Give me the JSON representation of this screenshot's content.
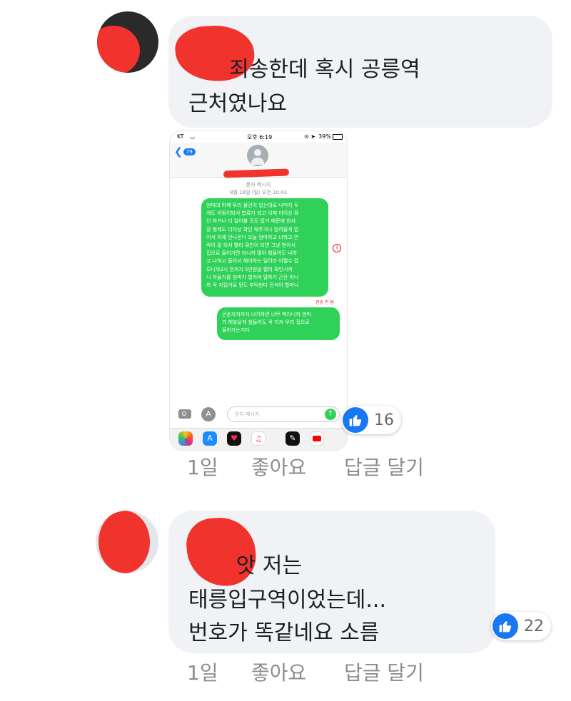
{
  "comments": [
    {
      "author": "",
      "text_lines": [
        "      죄송한데 혹시 공릉역",
        "근처였나요"
      ],
      "actions": {
        "time": "1일",
        "like": "좋아요",
        "reply": "답글 달기"
      },
      "reaction_count": "16"
    },
    {
      "author": "",
      "text_lines": [
        "       앗 저는",
        "태릉입구역이었는데...",
        "번호가 똑같네요 소름"
      ],
      "actions": {
        "time": "1일",
        "like": "좋아요",
        "reply": "답글 달기"
      },
      "reaction_count": "22"
    }
  ],
  "phone": {
    "carrier": "KT",
    "time": "오후 6:19",
    "battery": "39%",
    "back_badge": "79",
    "thread_label": "문자 메시지",
    "date_label": "8월 18일 (일) 오전 10:42",
    "message1": "엄마데 어제 우리 물건이 있는대로 나머지 두\n개도 이동이되서 합류가 되고 이제 더이상 확\n인 하거나 더 알아볼 것도 없기 때문에 한사\n장 형제도 더이상 확인 해주거나 알려줄게 없\n어서 이제 안나온다 오늘 엄마하고 너하고 연\n락이 잘 되서 빨리 확인이 되면 그냥 받아서\n집으로 들어가면 되니까 많이 힘들어도 나하\n고 나하고 둘이서 해야하는 일이라 어쩔수 없\n으니까2시 전까지 5만원을 빨리 확인시켜\n니 아들거를 엄마가 할거야 말하기 곤란 하니\n까 꼭 지킬거로 믿도 부탁한다 진석이 할머니",
    "not_sent": "전송 안 됨",
    "message2": "큰손자꺼까지 너가하면 너무 벅차니까 엄마\n가 해놓을게 힘들어도 꼭 지켜 우리 집으로\n들어가는거다",
    "input_placeholder": "문자 메시지"
  },
  "colors": {
    "bubble": "#f0f2f5",
    "like_blue": "#1877f2",
    "imessage_green": "#30d158",
    "redaction": "#f0332d"
  }
}
